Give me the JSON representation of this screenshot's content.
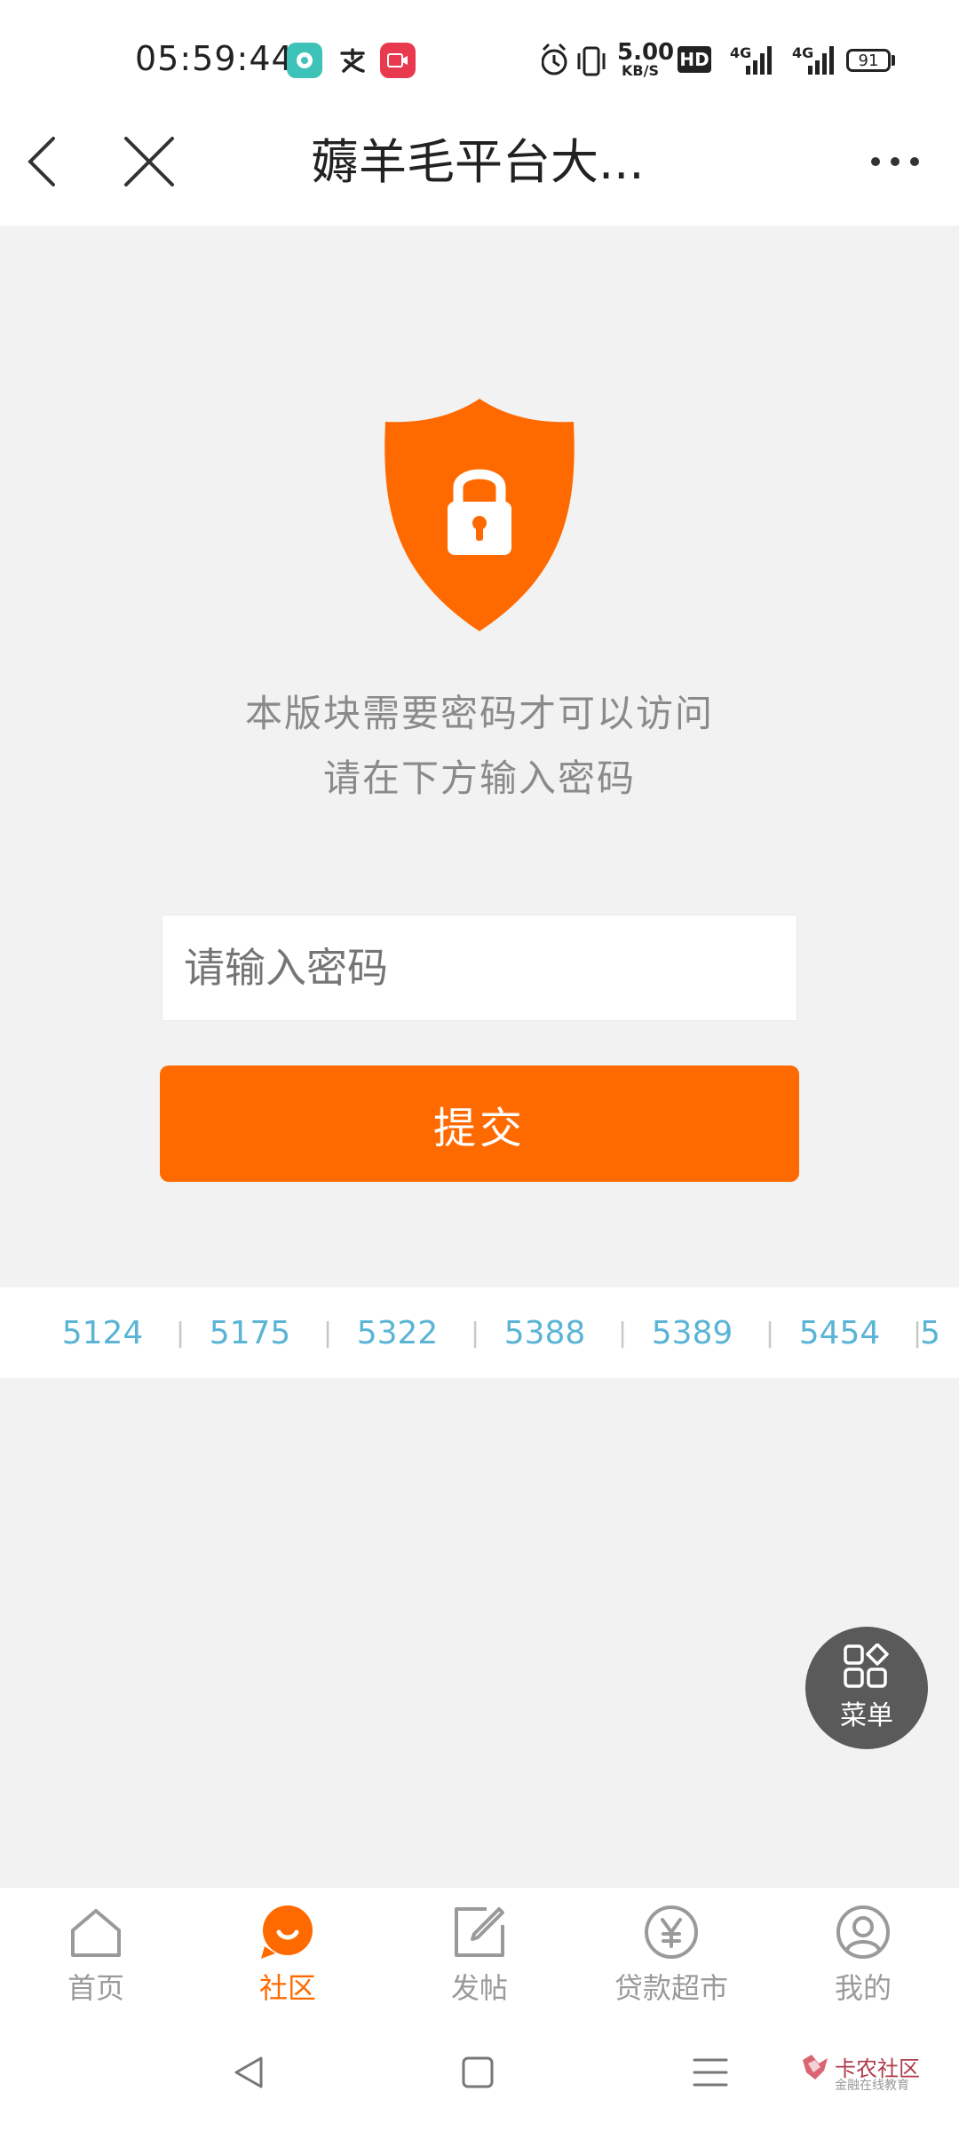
{
  "status_bar": {
    "time": "05:59:44",
    "network_speed_value": "5.00",
    "network_speed_unit": "KB/S",
    "hd_badge": "HD",
    "signal_1_label": "4G",
    "signal_2_label": "4G",
    "battery_level": "91",
    "app_icons": [
      "chat-bubble-icon",
      "alipay-icon",
      "video-recorder-icon"
    ]
  },
  "title_bar": {
    "title": "薅羊毛平台大...",
    "back_icon": "chevron-left-icon",
    "close_icon": "close-icon",
    "more_icon": "more-dots-icon"
  },
  "lock_screen": {
    "icon": "shield-lock-icon",
    "line1": "本版块需要密码才可以访问",
    "line2": "请在下方输入密码",
    "input_placeholder": "请输入密码",
    "submit_label": "提交"
  },
  "number_strip": {
    "items": [
      "5124",
      "5175",
      "5322",
      "5388",
      "5389",
      "5454",
      "5"
    ],
    "separator": "|"
  },
  "menu_fab": {
    "label": "菜单",
    "icon": "grid-diamond-icon"
  },
  "tab_bar": {
    "tabs": [
      {
        "label": "首页",
        "icon": "home-icon",
        "active": false
      },
      {
        "label": "社区",
        "icon": "community-smile-icon",
        "active": true
      },
      {
        "label": "发帖",
        "icon": "compose-icon",
        "active": false
      },
      {
        "label": "贷款超市",
        "icon": "yen-coin-icon",
        "active": false
      },
      {
        "label": "我的",
        "icon": "user-profile-icon",
        "active": false
      }
    ]
  },
  "system_nav": {
    "back_icon": "triangle-back-icon",
    "home_icon": "square-home-icon",
    "menu_icon": "hamburger-icon"
  },
  "watermark": {
    "text": "卡农社区",
    "sub": "金融在线教育"
  },
  "colors": {
    "accent": "#ff6a00",
    "strip_number": "#5ab4d6",
    "fab": "#5a5a5a",
    "background": "#f2f2f2"
  }
}
